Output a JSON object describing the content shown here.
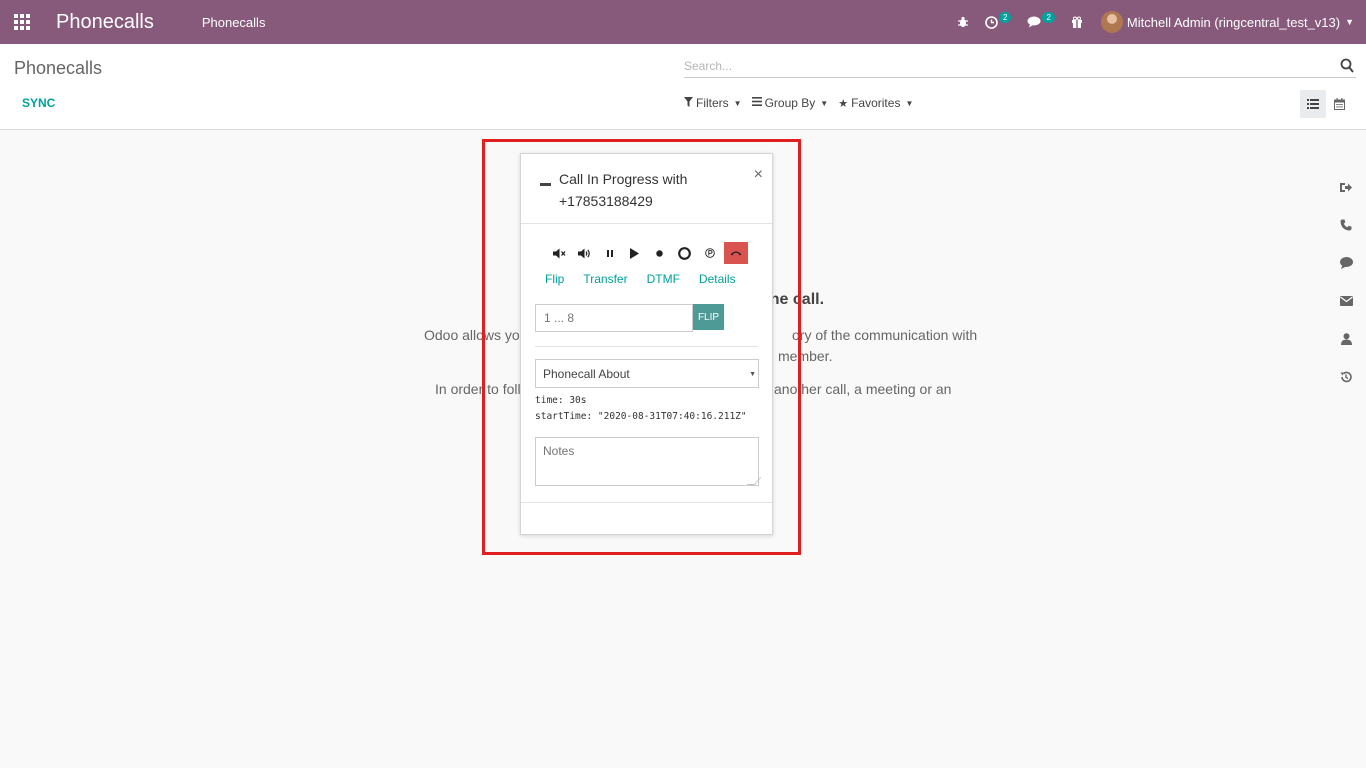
{
  "navbar": {
    "app_name": "Phonecalls",
    "menu": [
      "Phonecalls"
    ],
    "activity_badge": "2",
    "messages_badge": "2",
    "user_name": "Mitchell Admin (ringcentral_test_v13)",
    "bg_color": "#875a7b"
  },
  "control_panel": {
    "breadcrumb": "Phonecalls",
    "sync_label": "SYNC",
    "search_placeholder": "Search...",
    "filters_label": "Filters",
    "groupby_label": "Group By",
    "favorites_label": "Favorites"
  },
  "help": {
    "title_fragment": "one call.",
    "line1_left": "Odoo allows you t",
    "line1_right": "ory of the communication with",
    "line2_right": "member.",
    "line3_left": "In order to follo",
    "line3_right": "another call, a meeting or an"
  },
  "dialog": {
    "title_line1": "Call In Progress with",
    "title_line2": "+17853188429",
    "close": "×",
    "links": [
      "Flip",
      "Transfer",
      "DTMF",
      "Details"
    ],
    "flip_placeholder": "1 ... 8",
    "flip_button": "FLIP",
    "about_select": "Phonecall About",
    "time_line": "time: 30s",
    "start_time_line": "startTime: \"2020-08-31T07:40:16.211Z\"",
    "notes_placeholder": "Notes",
    "hangup_color": "#d9534f",
    "accent_color": "#00a09d"
  },
  "highlight_color": "#e02020"
}
